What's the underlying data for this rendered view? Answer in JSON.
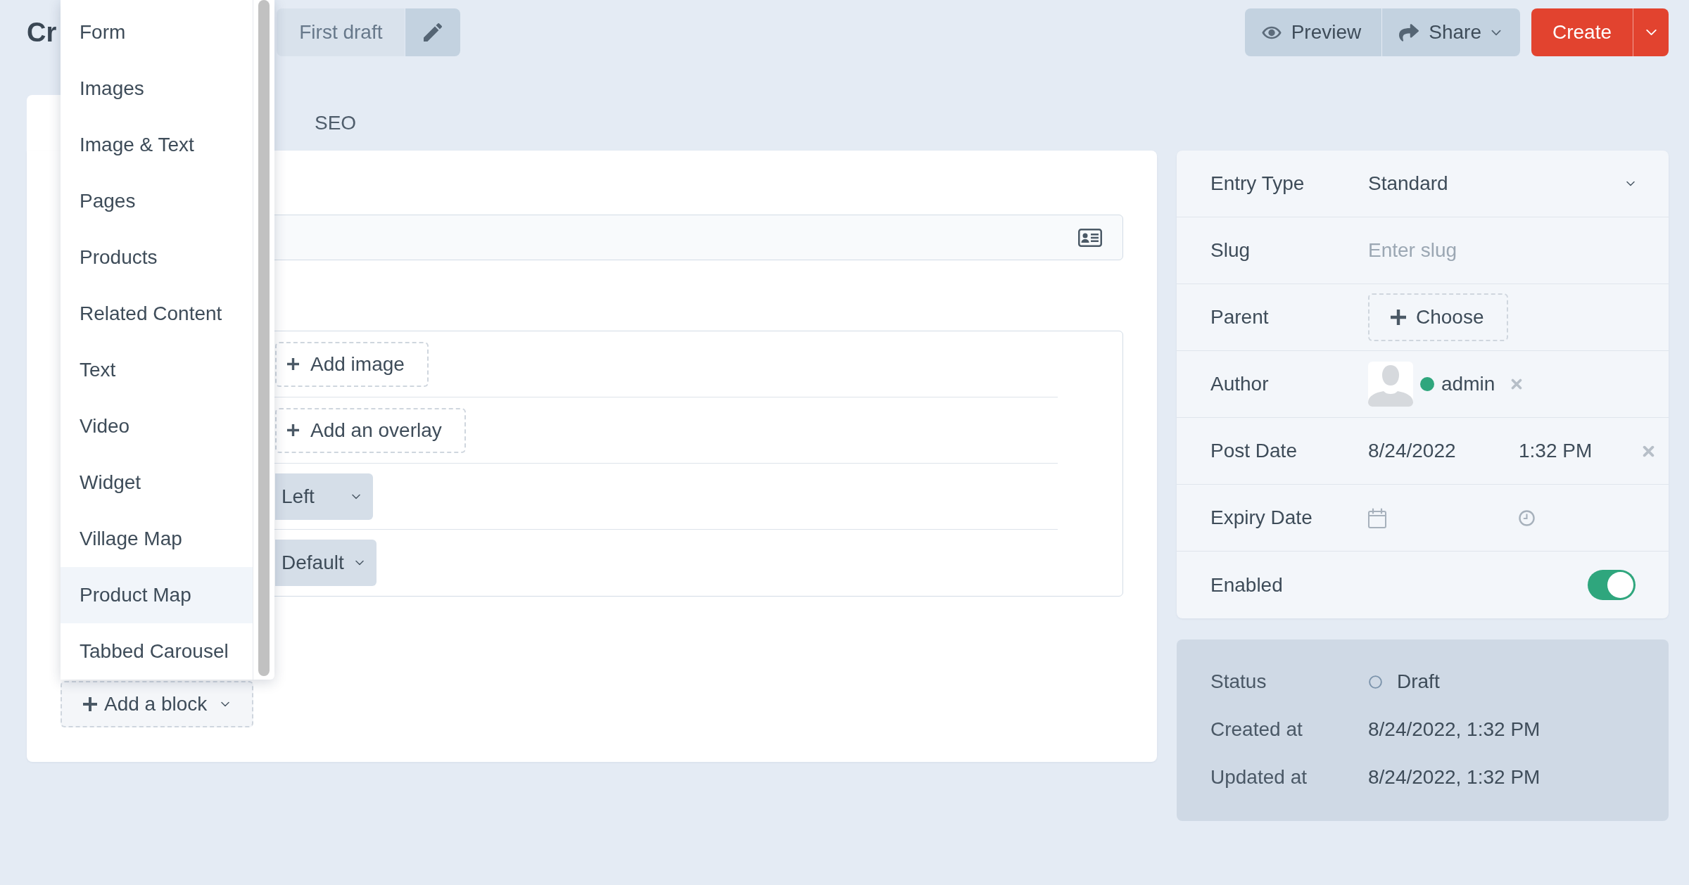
{
  "header": {
    "title": "Cr",
    "revision": "First draft",
    "actions": [
      {
        "kind": "preview",
        "label": "Preview"
      },
      {
        "kind": "share",
        "label": "Share"
      }
    ],
    "primary": {
      "label": "Create"
    }
  },
  "tabs": [
    {
      "selected": true
    },
    {
      "label": "SEO",
      "selected": false
    }
  ],
  "block_fields": [
    {
      "kind": "add",
      "label": "Add image"
    },
    {
      "kind": "add",
      "label": "Add an overlay"
    },
    {
      "kind": "select",
      "value": "Left"
    },
    {
      "kind": "select",
      "value": "Default"
    }
  ],
  "add_block": {
    "label": "Add a block"
  },
  "block_menu": {
    "items": [
      {
        "label": "Form",
        "selected": false
      },
      {
        "label": "Images",
        "selected": false
      },
      {
        "label": "Image & Text",
        "selected": false
      },
      {
        "label": "Pages",
        "selected": false
      },
      {
        "label": "Products",
        "selected": false
      },
      {
        "label": "Related Content",
        "selected": false
      },
      {
        "label": "Text",
        "selected": false
      },
      {
        "label": "Video",
        "selected": false
      },
      {
        "label": "Widget",
        "selected": false
      },
      {
        "label": "Village Map",
        "selected": false
      },
      {
        "label": "Product Map",
        "selected": true
      },
      {
        "label": "Tabbed Carousel",
        "selected": false
      }
    ]
  },
  "entry_settings": [
    {
      "kind": "select",
      "label": "Entry Type",
      "value": "Standard"
    },
    {
      "kind": "text",
      "label": "Slug",
      "placeholder": "Enter slug"
    },
    {
      "kind": "choose",
      "label": "Parent",
      "button": "Choose"
    },
    {
      "kind": "user",
      "label": "Author",
      "user": "admin",
      "online": true
    },
    {
      "kind": "datetime",
      "label": "Post Date",
      "date": "8/24/2022",
      "time": "1:32 PM"
    },
    {
      "kind": "datetime",
      "label": "Expiry Date"
    },
    {
      "kind": "toggle",
      "label": "Enabled",
      "on": true
    }
  ],
  "meta": [
    {
      "kind": "status",
      "label": "Status",
      "value": "Draft"
    },
    {
      "kind": "text",
      "label": "Created at",
      "value": "8/24/2022, 1:32 PM"
    },
    {
      "kind": "text",
      "label": "Updated at",
      "value": "8/24/2022, 1:32 PM"
    }
  ]
}
